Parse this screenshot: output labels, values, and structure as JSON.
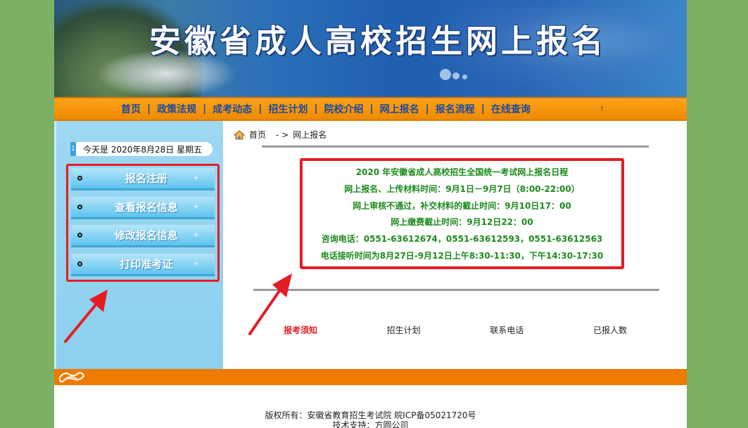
{
  "banner": {
    "title": "安徽省成人高校招生网上报名"
  },
  "nav": {
    "items": [
      "首页",
      "政策法规",
      "成考动态",
      "招生计划",
      "院校介绍",
      "网上报名",
      "报名流程",
      "在线查询"
    ],
    "separator": "|",
    "trailing": "?"
  },
  "sidebar": {
    "date_badge": "1",
    "date_text": "今天是 2020年8月28日 星期五",
    "menu": [
      "报名注册",
      "查看报名信息",
      "修改报名信息",
      "打印准考证"
    ],
    "plus": "+"
  },
  "breadcrumb": {
    "home": "首页",
    "arrow": "- >",
    "current": "网上报名"
  },
  "notice": {
    "lines": [
      "2020 年安徽省成人高校招生全国统一考试网上报名日程",
      "网上报名、上传材料时间：9月1日－9月7日（8:00-22:00）",
      "网上审核不通过，补交材料的截止时间：9月10日17：00",
      "网上缴费截止时间：9月12日22：00",
      "咨询电话：0551-63612674，0551-63612593，0551-63612563",
      "电话接听时间为8月27日-9月12日上午8:30-11:30，下午14:30-17:30"
    ]
  },
  "tabs": [
    "报考须知",
    "招生计划",
    "联系电话",
    "已报人数"
  ],
  "footer": {
    "copyright": "版权所有：安徽省教育招生考试院 皖ICP备05021720号",
    "support": "技术支持：方圆公司"
  },
  "colors": {
    "highlight": "#e51c23",
    "nav_bg": "#ff9900",
    "notice_text": "#1e8a1e",
    "sidebar_bg": "#8bd0ee"
  }
}
